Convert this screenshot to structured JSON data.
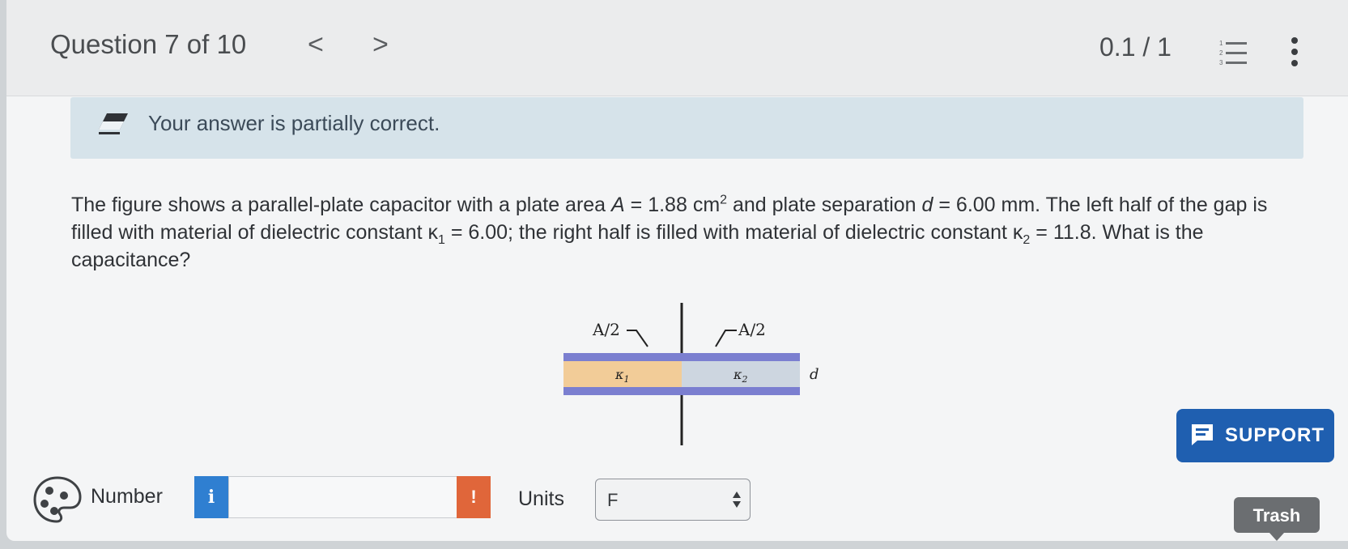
{
  "header": {
    "title": "Question 7 of 10",
    "prev": "<",
    "next": ">",
    "score": "0.1 / 1",
    "list_icon": "numbered-list-icon",
    "more_icon": "more-vertical-icon"
  },
  "banner": {
    "icon": "partial-credit-eraser-icon",
    "text": "Your answer is partially correct."
  },
  "question": {
    "p1": "The figure shows a parallel-plate capacitor with a plate area ",
    "A_var": "A",
    "p2": " = 1.88 cm",
    "exp2": "2",
    "p3": " and plate separation ",
    "d_var": "d",
    "p4": " = 6.00 mm. The left half of the gap is filled with material of dielectric constant κ",
    "sub1": "1",
    "p5": " = 6.00; the right half is filled with material of dielectric constant κ",
    "sub2": "2",
    "p6": " = 11.8. What is the capacitance?"
  },
  "figure": {
    "label_left": "A/2",
    "label_right": "A/2",
    "kappa1": "κ",
    "kappa1_sub": "1",
    "kappa2": "κ",
    "kappa2_sub": "2",
    "d_label": "d",
    "colors": {
      "plate": "#7b7fd0",
      "left_fill": "#f2cc98",
      "right_fill": "#cdd6e0",
      "wire": "#222222"
    }
  },
  "answer": {
    "palette_icon": "palette-icon",
    "number_label": "Number",
    "info_label": "i",
    "number_value": "",
    "warning_label": "!",
    "units_label": "Units",
    "units_value": "F"
  },
  "support": {
    "icon": "chat-icon",
    "label": "SUPPORT"
  },
  "trash": {
    "label": "Trash"
  },
  "colors": {
    "banner_bg": "#d6e3ea",
    "support_bg": "#1f5fb0",
    "info_bg": "#2f7fd1",
    "warning_bg": "#e0663a",
    "trash_bg": "#6b6e71"
  }
}
